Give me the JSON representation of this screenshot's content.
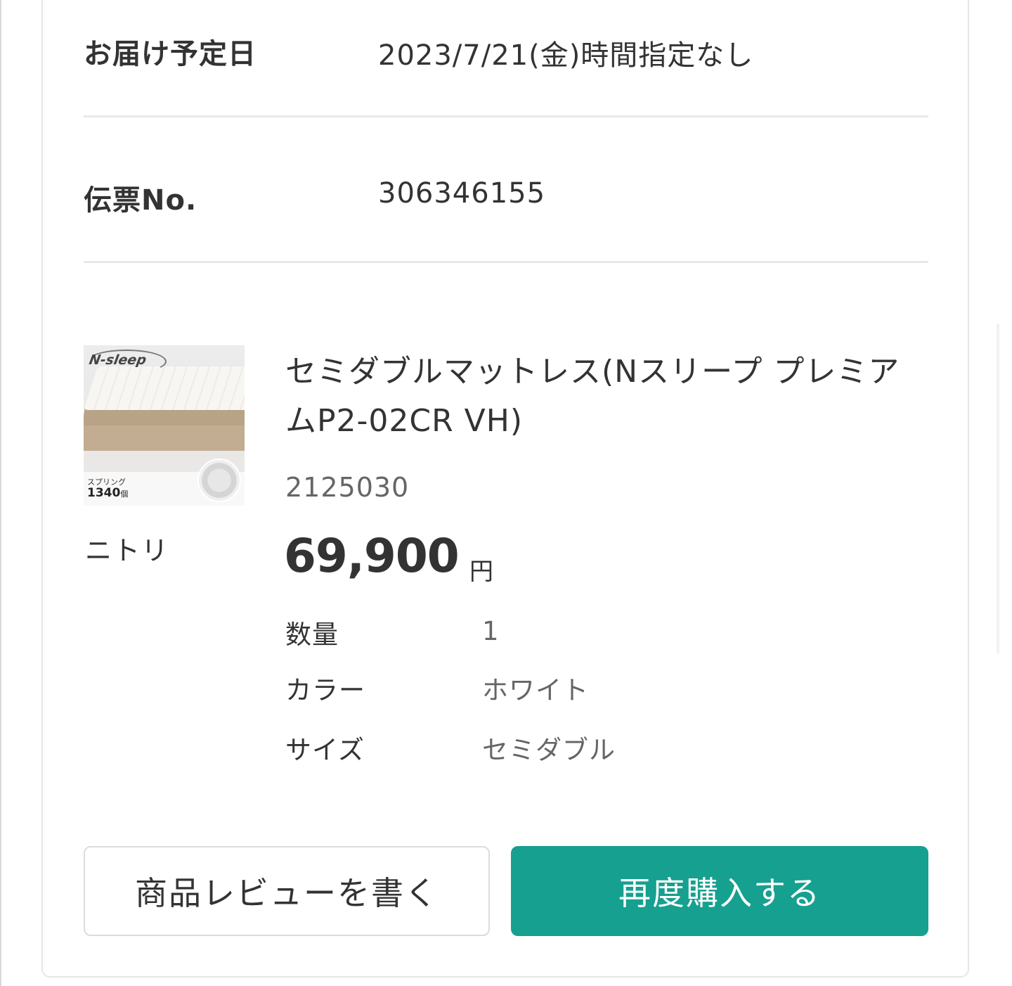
{
  "delivery": {
    "label": "お届け予定日",
    "value": "2023/7/21(金)時間指定なし"
  },
  "slip": {
    "label": "伝票No.",
    "value": "306346155"
  },
  "product": {
    "image": {
      "logo_text": "N-sleep",
      "caption": "スプリング",
      "count": "1340",
      "count_unit": "個"
    },
    "brand": "ニトリ",
    "title": "セミダブルマットレス(Nスリープ プレミアムP2-02CR VH)",
    "code": "2125030",
    "price": "69,900",
    "currency": "円",
    "specs": [
      {
        "label": "数量",
        "value": "1"
      },
      {
        "label": "カラー",
        "value": "ホワイト"
      },
      {
        "label": "サイズ",
        "value": "セミダブル"
      }
    ]
  },
  "buttons": {
    "review": "商品レビューを書く",
    "rebuy": "再度購入する"
  },
  "colors": {
    "accent": "#16a08f",
    "text": "#333333",
    "muted": "#666666",
    "divider": "#e8e8e8"
  }
}
